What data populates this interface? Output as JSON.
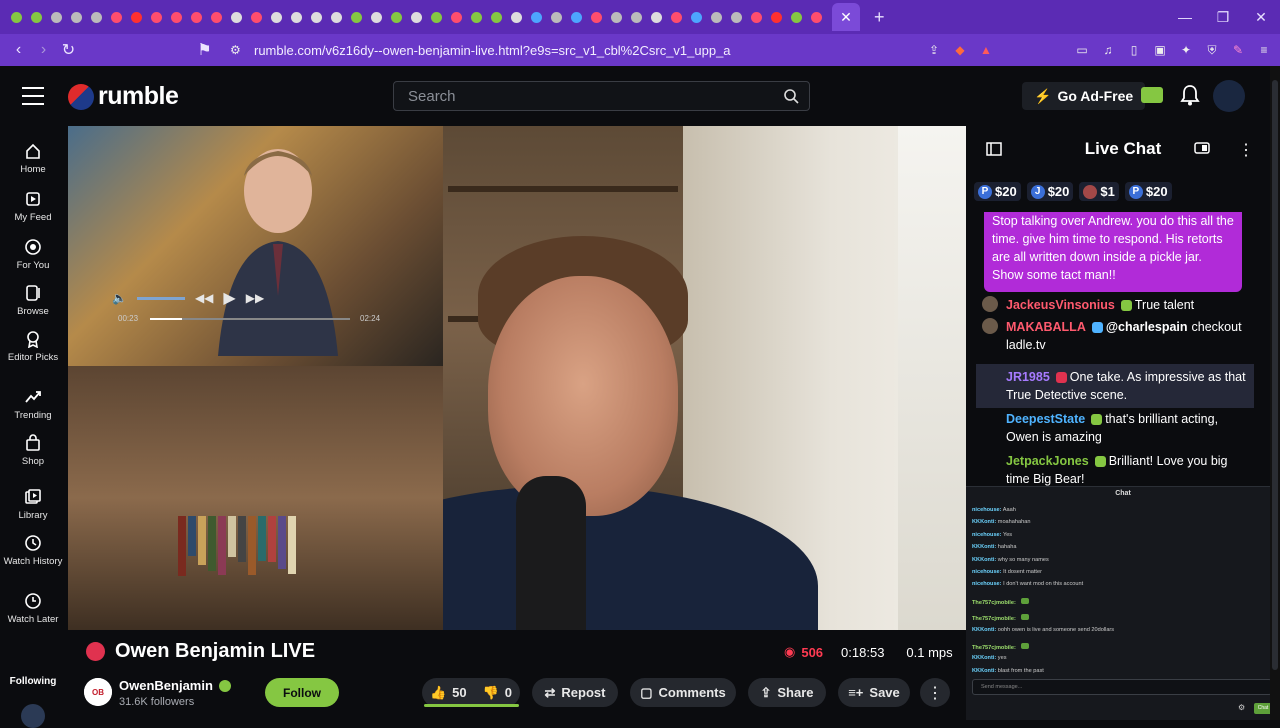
{
  "browser": {
    "url": "rumble.com/v6z16dy--owen-benjamin-live.html?e9s=src_v1_cbl%2Csrc_v1_upp_a",
    "tab_close": "✕",
    "new_tab": "+",
    "shield_badge": "1"
  },
  "header": {
    "logo_text": "rumble",
    "search_placeholder": "Search",
    "go_adfree": "Go Ad-Free"
  },
  "sidebar": {
    "items": [
      {
        "label": "Home",
        "icon": "home-icon"
      },
      {
        "label": "My Feed",
        "icon": "feed-icon"
      },
      {
        "label": "For You",
        "icon": "target-icon"
      },
      {
        "label": "Browse",
        "icon": "browse-icon"
      },
      {
        "label": "Editor Picks",
        "icon": "award-icon"
      },
      {
        "label": "Trending",
        "icon": "trending-icon"
      },
      {
        "label": "Shop",
        "icon": "shop-icon"
      },
      {
        "label": "Library",
        "icon": "library-icon"
      },
      {
        "label": "Watch History",
        "icon": "history-icon"
      },
      {
        "label": "Watch Later",
        "icon": "clock-icon"
      }
    ],
    "following": "Following"
  },
  "video": {
    "inset_time_current": "00:23",
    "inset_time_total": "02:24",
    "inset_progress": 0.16
  },
  "chat": {
    "title": "Live Chat",
    "tips": [
      {
        "letter": "P",
        "amount": "$20",
        "color": "#3b6fd8"
      },
      {
        "letter": "J",
        "amount": "$20",
        "color": "#3b6fd8"
      },
      {
        "letter": "",
        "amount": "$1",
        "color": "#a34848"
      },
      {
        "letter": "P",
        "amount": "$20",
        "color": "#3b6fd8"
      }
    ],
    "pinned": "Stop talking over Andrew. you do this all the time. give him time to respond. His retorts are all written down inside a pickle jar. Show some tact man!!",
    "messages": [
      {
        "user": "JackeusVinsonius",
        "text": "True talent",
        "color": "#ff5a6e"
      },
      {
        "user": "MAKABALLA",
        "mention": "@charlespain",
        "text": "checkout ladle.tv",
        "color": "#ff5a6e"
      },
      {
        "user": "JR1985",
        "text": "One take. As impressive as that True Detective scene.",
        "color": "#a77bff"
      },
      {
        "user": "DeepestState",
        "text": "that's brilliant acting, Owen is amazing",
        "color": "#4fb3ff"
      },
      {
        "user": "JetpackJones",
        "text": "Brilliant! Love you big time Big Bear!",
        "color": "#85c742"
      }
    ]
  },
  "chat2": {
    "title": "Chat",
    "lines": [
      {
        "user": "nicehouse:",
        "text": "Aaah"
      },
      {
        "user": "KKKonti:",
        "text": "moahahahan"
      },
      {
        "user": "nicehouse:",
        "text": "Yes"
      },
      {
        "user": "KKKonti:",
        "text": "hahaha"
      },
      {
        "user": "KKKonti:",
        "text": "why so many names"
      },
      {
        "user": "nicehouse:",
        "text": "It dosent matter"
      },
      {
        "user": "nicehouse:",
        "text": "I don't want mod on this account"
      },
      {
        "user": "The757cjmobile:",
        "text": ""
      },
      {
        "user": "The757cjmobile:",
        "text": ""
      },
      {
        "user": "KKKonti:",
        "text": "oohh owen is live and someone send 20dollars"
      },
      {
        "user": "The757cjmobile:",
        "text": ""
      },
      {
        "user": "KKKonti:",
        "text": "yes"
      },
      {
        "user": "KKKonti:",
        "text": "blast from the past"
      }
    ],
    "send_placeholder": "Send message...",
    "chat_button": "Chat"
  },
  "below": {
    "title": "Owen Benjamin LIVE",
    "viewers": "506",
    "duration": "0:18:53",
    "bitrate": "0.1 mps",
    "channel": "OwenBenjamin",
    "followers": "31.6K followers",
    "follow": "Follow",
    "likes": "50",
    "dislikes": "0",
    "repost": "Repost",
    "comments": "Comments",
    "share": "Share",
    "save": "Save"
  }
}
